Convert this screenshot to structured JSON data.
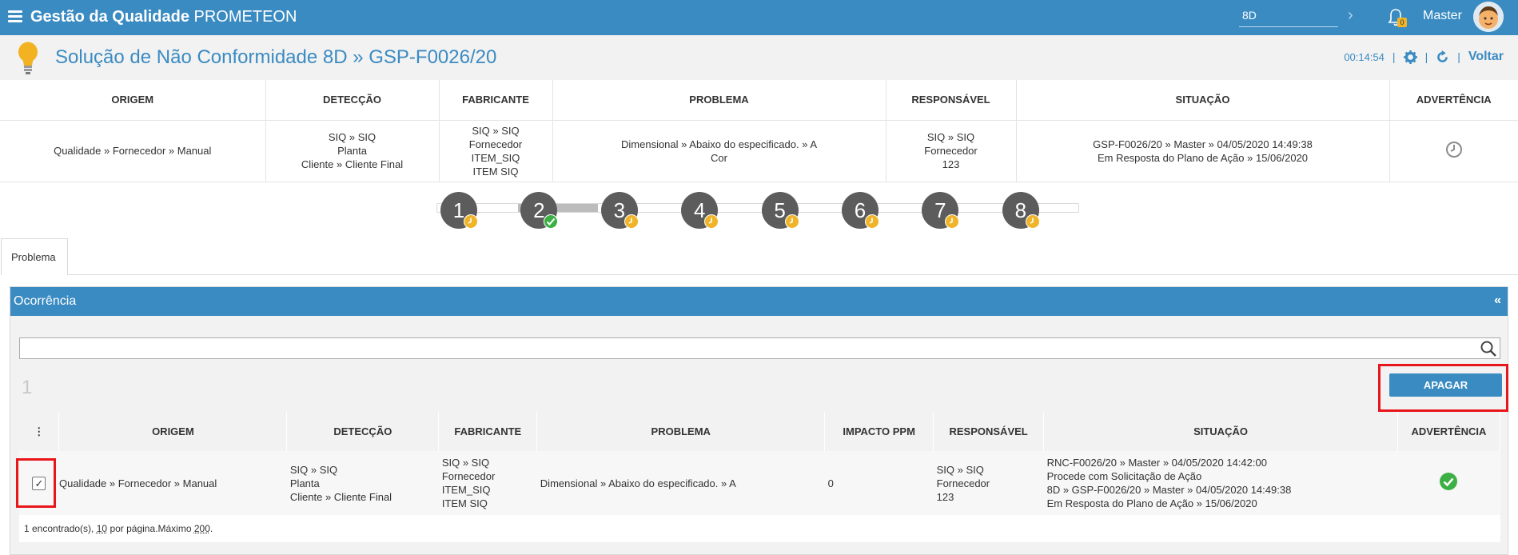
{
  "topbar": {
    "title_bold": "Gestão da Qualidade",
    "title_rest": "PROMETEON",
    "search_value": "8D",
    "notification_count": "0",
    "user_name": "Master"
  },
  "header": {
    "title": "Solução de Não Conformidade 8D » GSP-F0026/20",
    "timer": "00:14:54",
    "back_label": "Voltar"
  },
  "summary": {
    "columns": [
      "ORIGEM",
      "DETECÇÃO",
      "FABRICANTE",
      "PROBLEMA",
      "RESPONSÁVEL",
      "SITUAÇÃO",
      "ADVERTÊNCIA"
    ],
    "origem": "Qualidade » Fornecedor » Manual",
    "deteccao": [
      "SIQ » SIQ",
      "Planta",
      "Cliente » Cliente Final"
    ],
    "fabricante": [
      "SIQ » SIQ",
      "Fornecedor",
      "ITEM_SIQ",
      "ITEM SIQ"
    ],
    "problema": [
      "Dimensional » Abaixo do especificado. » A",
      "Cor"
    ],
    "responsavel": [
      "SIQ » SIQ",
      "Fornecedor",
      "123"
    ],
    "situacao": [
      "GSP-F0026/20 » Master » 04/05/2020 14:49:38",
      "Em Resposta do Plano de Ação » 15/06/2020"
    ]
  },
  "steps": [
    {
      "label": "1",
      "status": "pending"
    },
    {
      "label": "2",
      "status": "done"
    },
    {
      "label": "3",
      "status": "pending"
    },
    {
      "label": "4",
      "status": "pending"
    },
    {
      "label": "5",
      "status": "pending"
    },
    {
      "label": "6",
      "status": "pending"
    },
    {
      "label": "7",
      "status": "pending"
    },
    {
      "label": "8",
      "status": "pending"
    }
  ],
  "tabs": [
    {
      "label": "Problema",
      "active": true
    }
  ],
  "panel": {
    "title": "Ocorrência",
    "collapse": "«",
    "filter_value": "",
    "page_number": "1",
    "delete_label": "APAGAR"
  },
  "results": {
    "menu_icon": "⋮",
    "columns": [
      "ORIGEM",
      "DETECÇÃO",
      "FABRICANTE",
      "PROBLEMA",
      "IMPACTO PPM",
      "RESPONSÁVEL",
      "SITUAÇÃO",
      "ADVERTÊNCIA"
    ],
    "row": {
      "checked": true,
      "checkmark": "✓",
      "origem": "Qualidade » Fornecedor » Manual",
      "deteccao": [
        "SIQ » SIQ",
        "Planta",
        "Cliente » Cliente Final"
      ],
      "fabricante": [
        "SIQ » SIQ",
        "Fornecedor",
        "ITEM_SIQ",
        "ITEM SIQ"
      ],
      "problema": "Dimensional » Abaixo do especificado. » A",
      "impacto": "0",
      "responsavel": [
        "SIQ » SIQ",
        "Fornecedor",
        "123"
      ],
      "situacao": [
        "RNC-F0026/20 » Master » 04/05/2020 14:42:00",
        "Procede com Solicitação de Ação",
        "8D » GSP-F0026/20 » Master » 04/05/2020 14:49:38",
        "Em Resposta do Plano de Ação » 15/06/2020"
      ]
    },
    "footer": {
      "found": "1 encontrado(s),",
      "per_page_count": "10",
      "per_page_text": "por página.Máximo",
      "max": "200",
      "end": "."
    }
  },
  "colors": {
    "primary": "#3a8bc2",
    "pending": "#f0b429",
    "ok": "#3cb044",
    "highlight": "#e8161b"
  }
}
